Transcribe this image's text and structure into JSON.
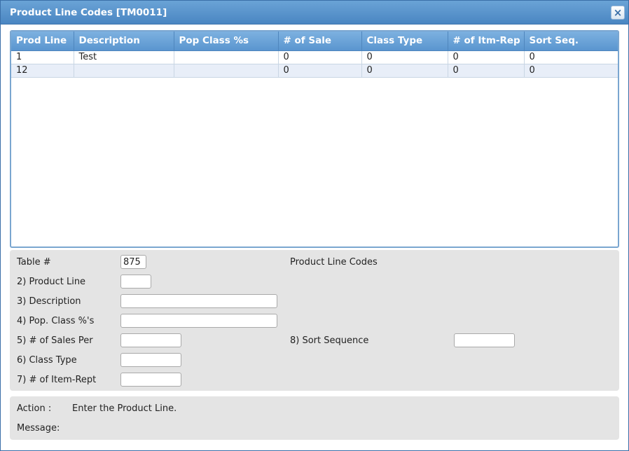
{
  "window": {
    "title": "Product Line Codes [TM0011]",
    "close_glyph": "×"
  },
  "grid": {
    "columns": [
      "Prod Line",
      "Description",
      "Pop Class %s",
      "# of Sale",
      "Class Type",
      "# of Itm-Rep",
      "Sort Seq."
    ],
    "rows": [
      [
        "1",
        "Test",
        "",
        "0",
        "0",
        "0",
        "0"
      ],
      [
        "12",
        "",
        "",
        "0",
        "0",
        "0",
        "0"
      ]
    ]
  },
  "form": {
    "table_label": "Table #",
    "table_value": "875",
    "table_title": "Product Line Codes",
    "fields": {
      "product_line": {
        "label": "2) Product Line",
        "value": ""
      },
      "description": {
        "label": "3) Description",
        "value": ""
      },
      "pop_class": {
        "label": "4) Pop. Class %'s",
        "value": ""
      },
      "sales_per": {
        "label": "5) # of Sales Per",
        "value": ""
      },
      "class_type": {
        "label": "6) Class Type",
        "value": ""
      },
      "item_rept": {
        "label": "7) # of Item-Rept",
        "value": ""
      },
      "sort_sequence": {
        "label": "8) Sort Sequence",
        "value": ""
      }
    }
  },
  "status": {
    "action_label": "Action :",
    "action_text": "Enter the Product Line.",
    "message_label": "Message:",
    "message_text": ""
  }
}
